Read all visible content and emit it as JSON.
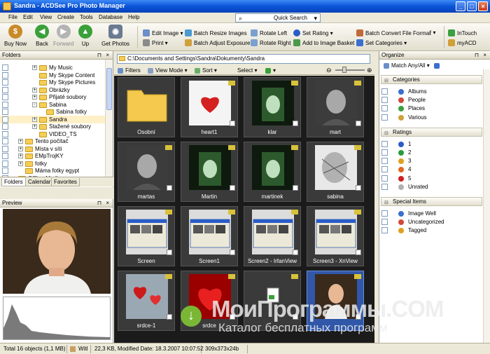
{
  "window": {
    "title": "Sandra - ACDSee Pro Photo Manager"
  },
  "menu": [
    "File",
    "Edit",
    "View",
    "Create",
    "Tools",
    "Database",
    "Help"
  ],
  "quick_search": {
    "label": "Quick Search"
  },
  "toolbar": {
    "buy_now": "Buy Now",
    "back": "Back",
    "forward": "Forward",
    "up": "Up",
    "get_photos": "Get Photos",
    "edit_image": "Edit Image",
    "print": "Print",
    "batch_resize": "Batch Resize Images",
    "batch_adjust": "Batch Adjust Exposure",
    "rotate_left": "Rotate Left",
    "rotate_right": "Rotate Right",
    "set_rating": "Set Rating",
    "add_basket": "Add to Image Basket",
    "batch_convert": "Batch Convert File Format",
    "set_categories": "Set Categories",
    "intouch": "InTouch",
    "myacd": "myACD"
  },
  "folders_panel": {
    "title": "Folders",
    "items": [
      {
        "label": "My Music",
        "indent": 3,
        "expander": "+"
      },
      {
        "label": "My Skype Content",
        "indent": 3,
        "expander": ""
      },
      {
        "label": "My Skype Pictures",
        "indent": 3,
        "expander": ""
      },
      {
        "label": "Obrázky",
        "indent": 3,
        "expander": "+"
      },
      {
        "label": "Přijaté soubory",
        "indent": 3,
        "expander": "+"
      },
      {
        "label": "Sabina",
        "indent": 3,
        "expander": "-"
      },
      {
        "label": "Sabina fotky",
        "indent": 4,
        "expander": ""
      },
      {
        "label": "Sandra",
        "indent": 3,
        "expander": "+",
        "selected": true
      },
      {
        "label": "Stažené soubory",
        "indent": 3,
        "expander": "+"
      },
      {
        "label": "VIDEO_TS",
        "indent": 3,
        "expander": ""
      },
      {
        "label": "Tento počítač",
        "indent": 1,
        "expander": "+"
      },
      {
        "label": "Místa v síti",
        "indent": 1,
        "expander": "+"
      },
      {
        "label": "EMpTrojKY",
        "indent": 1,
        "expander": "+"
      },
      {
        "label": "fotky",
        "indent": 1,
        "expander": "+"
      },
      {
        "label": "Máma fotky egypt",
        "indent": 1,
        "expander": ""
      },
      {
        "label": "Offline Media",
        "indent": 0,
        "expander": ""
      }
    ],
    "tabs": [
      "Folders",
      "Calendar",
      "Favorites"
    ]
  },
  "preview_panel": {
    "title": "Preview"
  },
  "path": "C:\\Documents and Settings\\Sandra\\Dokumenty\\Sandra",
  "viewbar": {
    "filters": "Filters",
    "view_mode": "View Mode",
    "sort": "Sort",
    "select": "Select"
  },
  "thumbnails": [
    {
      "label": "Osobní",
      "kind": "folder"
    },
    {
      "label": "heart1",
      "kind": "heart"
    },
    {
      "label": "klar",
      "kind": "green"
    },
    {
      "label": "mart",
      "kind": "gray"
    },
    {
      "label": "martas",
      "kind": "gray"
    },
    {
      "label": "Martin",
      "kind": "green"
    },
    {
      "label": "martinek",
      "kind": "green"
    },
    {
      "label": "sabina",
      "kind": "light"
    },
    {
      "label": "Screen",
      "kind": "screen"
    },
    {
      "label": "Screen1",
      "kind": "screen"
    },
    {
      "label": "Screen2 - IrfanView",
      "kind": "screen"
    },
    {
      "label": "Screen3 - XnView",
      "kind": "screen"
    },
    {
      "label": "srdce-1",
      "kind": "hearts"
    },
    {
      "label": "srdce",
      "kind": "redheart"
    },
    {
      "label": "",
      "kind": "doc"
    },
    {
      "label": "",
      "kind": "portrait",
      "selected": true
    }
  ],
  "organize": {
    "title": "Organize",
    "match": "Match Any/All",
    "categories_title": "Categories",
    "categories": [
      {
        "label": "Albums",
        "color": "#3a6fd0"
      },
      {
        "label": "People",
        "color": "#d04a3a"
      },
      {
        "label": "Places",
        "color": "#3aa040"
      },
      {
        "label": "Various",
        "color": "#d0a03a"
      }
    ],
    "ratings_title": "Ratings",
    "ratings": [
      {
        "label": "1",
        "color": "#2a5cc8"
      },
      {
        "label": "2",
        "color": "#2a9c3a"
      },
      {
        "label": "3",
        "color": "#e0a020"
      },
      {
        "label": "4",
        "color": "#e06820"
      },
      {
        "label": "5",
        "color": "#d02020"
      },
      {
        "label": "Unrated",
        "color": "#b0b0b0"
      }
    ],
    "special_title": "Special Items",
    "special": [
      {
        "label": "Image Well",
        "color": "#3a6fd0"
      },
      {
        "label": "Uncategorized",
        "color": "#d04a3a"
      },
      {
        "label": "Tagged",
        "color": "#e0a020"
      }
    ]
  },
  "status": {
    "total": "Total 16 objects  (1,1 MB)",
    "name": "Witl",
    "info": "22,3 KB, Modified Date: 18.3.2007 10:07:52",
    "dims": "309x373x24b"
  },
  "watermark": {
    "line1": "МоиПрограммы.COM",
    "line2": "Каталог бесплатных программ"
  }
}
